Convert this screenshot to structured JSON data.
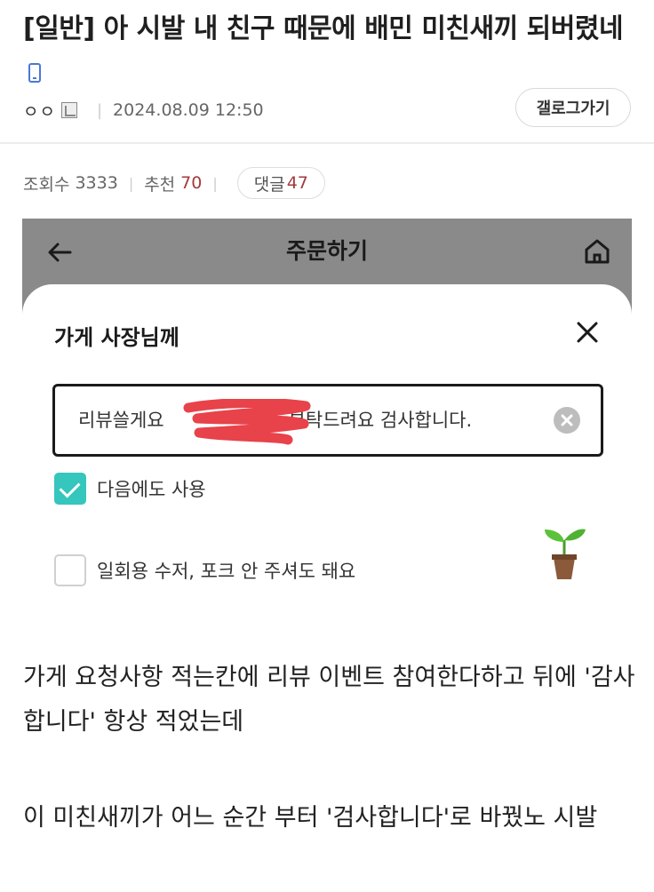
{
  "post": {
    "title": "[일반] 아 시발 내 친구 때문에 배민 미친새끼 되버렸네",
    "author": "ㅇㅇ",
    "date": "2024.08.09 12:50",
    "gallery_button": "갤로그가기"
  },
  "stats": {
    "views_label": "조회수",
    "views_value": "3333",
    "recommend_label": "추천",
    "recommend_value": "70",
    "comments_label": "댓글",
    "comments_value": "47"
  },
  "screenshot": {
    "header_title": "주문하기",
    "sheet_title": "가게 사장님께",
    "request_text_before": "리뷰쓸게요",
    "request_text_after": "부탁드려요 검사합니다.",
    "checkbox1_label": "다음에도 사용",
    "checkbox1_checked": true,
    "checkbox2_label": "일회용 수저, 포크 안 주셔도 돼요",
    "checkbox2_checked": false,
    "accent_color": "#35c6bd",
    "header_color": "#8a8a8a"
  },
  "body": {
    "paragraph1": "가게 요청사항 적는칸에 리뷰 이벤트 참여한다하고 뒤에 '감사합니다' 항상 적었는데",
    "paragraph2": "이 미친새끼가 어느 순간 부터 '검사합니다'로 바꿨노 시발"
  }
}
